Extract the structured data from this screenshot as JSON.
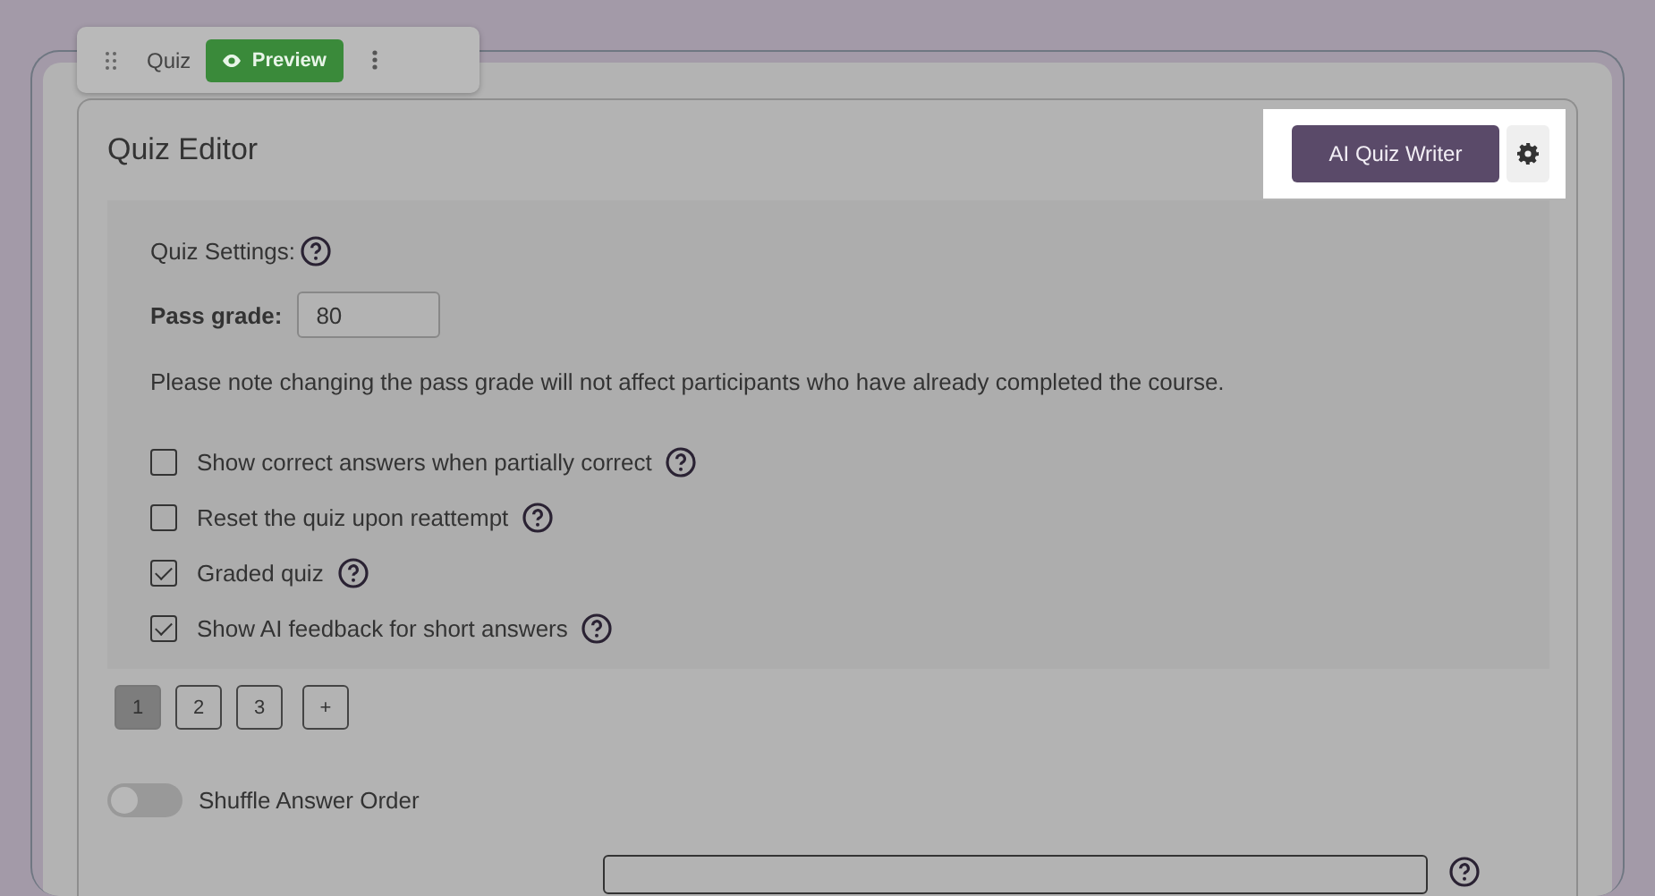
{
  "toolbar": {
    "label": "Quiz",
    "preview_button": "Preview"
  },
  "editor": {
    "title": "Quiz Editor",
    "ai_button": "AI Quiz Writer"
  },
  "settings": {
    "heading": "Quiz Settings:",
    "pass_grade": {
      "label": "Pass grade:",
      "value": "80"
    },
    "note": "Please note changing the pass grade will not affect participants who have already completed the course.",
    "options": [
      {
        "label": "Show correct answers when partially correct",
        "checked": false
      },
      {
        "label": "Reset the quiz upon reattempt",
        "checked": false
      },
      {
        "label": "Graded quiz",
        "checked": true
      },
      {
        "label": "Show AI feedback for short answers",
        "checked": true
      }
    ]
  },
  "pages": [
    {
      "label": "1",
      "selected": true
    },
    {
      "label": "2",
      "selected": false
    },
    {
      "label": "3",
      "selected": false
    }
  ],
  "add_page_button": "+",
  "shuffle": {
    "label": "Shuffle Answer Order",
    "on": false
  }
}
